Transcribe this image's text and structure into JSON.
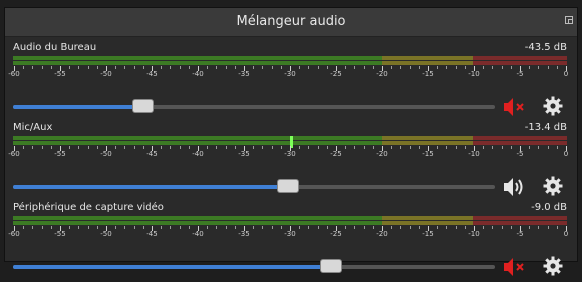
{
  "window": {
    "title": "Mélangeur audio"
  },
  "meter_scale": [
    "-60",
    "-55",
    "-50",
    "-45",
    "-40",
    "-35",
    "-30",
    "-25",
    "-20",
    "-15",
    "-10",
    "-5",
    "0"
  ],
  "channels": [
    {
      "name": "Audio du Bureau",
      "level": "-43.5 dB",
      "volume": 0.27,
      "muted": true,
      "mute_icon": "speaker-muted-icon"
    },
    {
      "name": "Mic/Aux",
      "level": "-13.4 dB",
      "volume": 0.57,
      "muted": false,
      "mute_icon": "speaker-on-icon"
    },
    {
      "name": "Périphérique de capture vidéo",
      "level": "-9.0 dB",
      "volume": 0.66,
      "muted": true,
      "mute_icon": "speaker-muted-icon"
    }
  ],
  "colors": {
    "accent": "#3f7fd4",
    "muted": "#e02020",
    "meter_green": "#3c7a24",
    "meter_yellow": "#7a7326",
    "meter_red": "#7a2b2b"
  }
}
